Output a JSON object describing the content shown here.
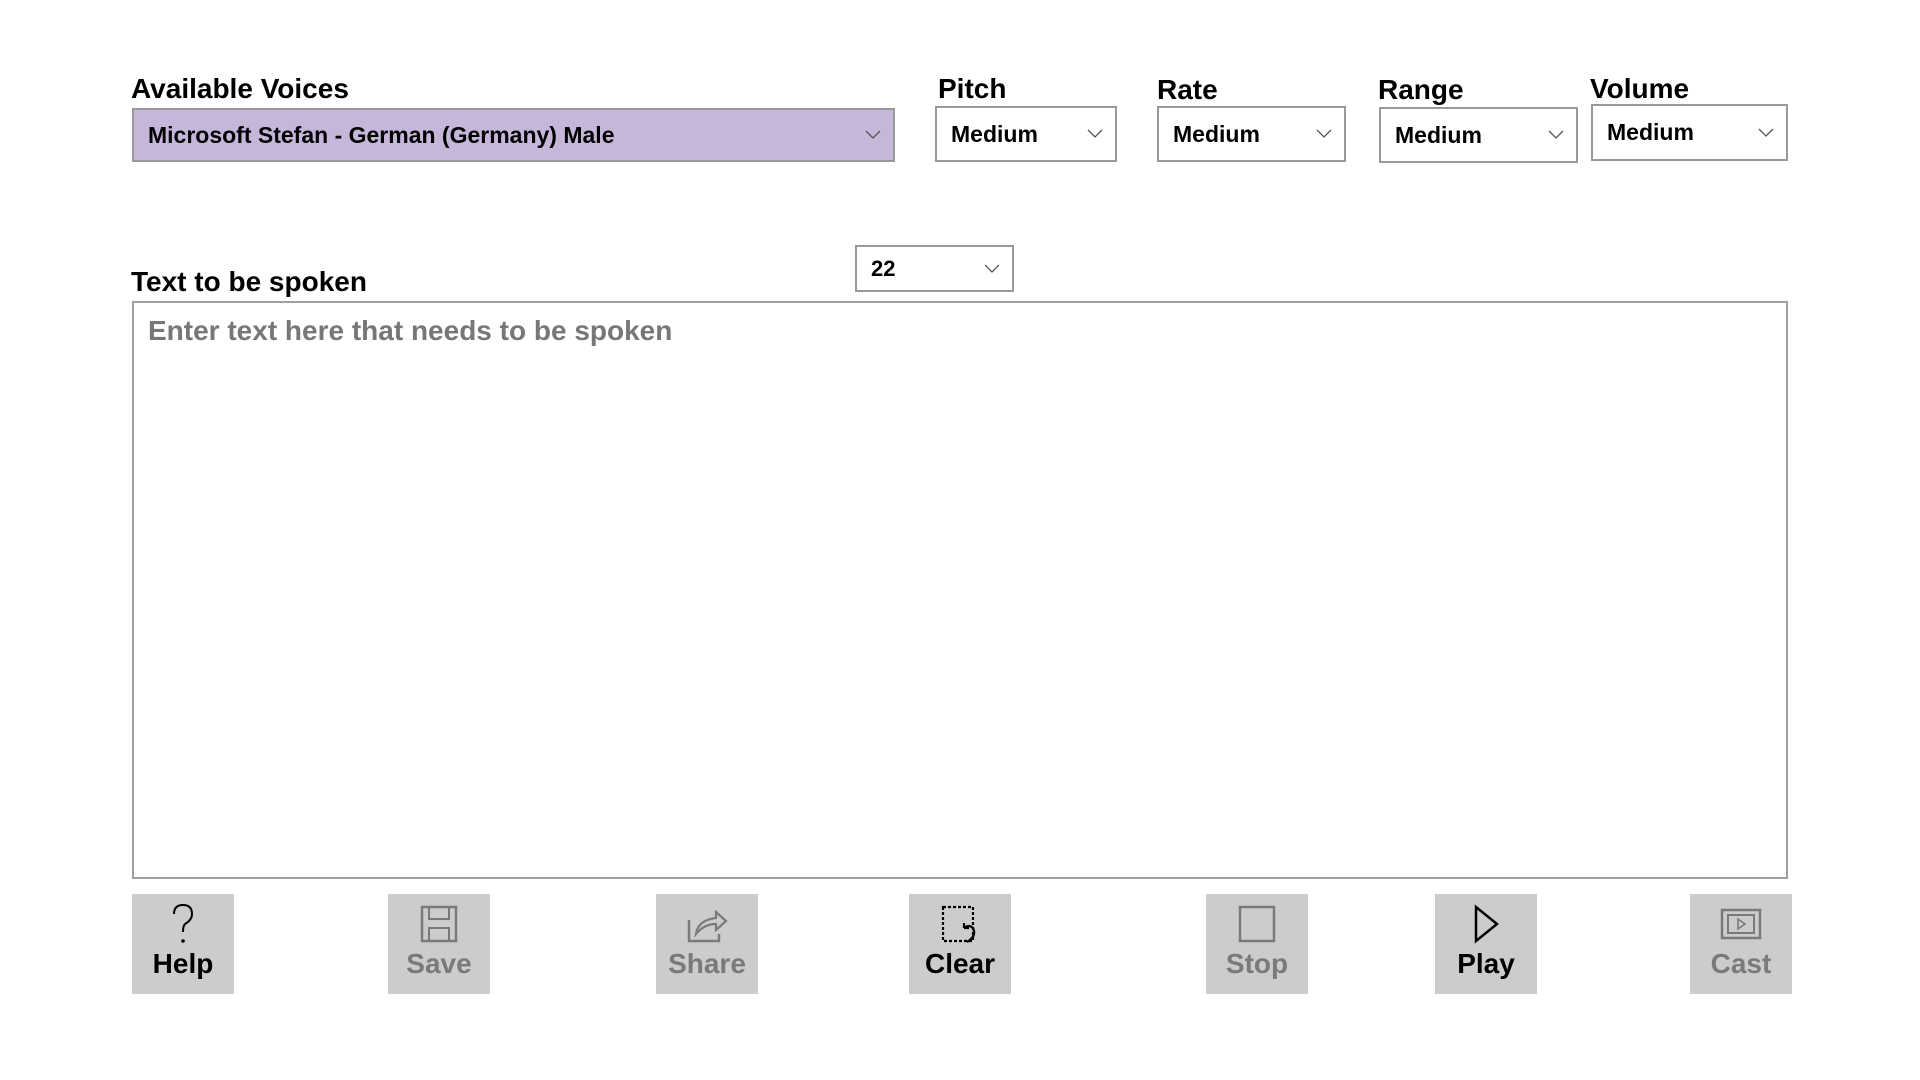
{
  "voices": {
    "label": "Available Voices",
    "selected": "Microsoft Stefan - German (Germany) Male"
  },
  "pitch": {
    "label": "Pitch",
    "selected": "Medium"
  },
  "rate": {
    "label": "Rate",
    "selected": "Medium"
  },
  "range": {
    "label": "Range",
    "selected": "Medium"
  },
  "volume": {
    "label": "Volume",
    "selected": "Medium"
  },
  "font_size": {
    "selected": "22"
  },
  "text": {
    "label": "Text to be spoken",
    "placeholder": "Enter text here that needs to be spoken",
    "value": ""
  },
  "buttons": [
    {
      "label": "Help",
      "icon": "question-icon",
      "enabled": true
    },
    {
      "label": "Save",
      "icon": "floppy-icon",
      "enabled": false
    },
    {
      "label": "Share",
      "icon": "share-icon",
      "enabled": false
    },
    {
      "label": "Clear",
      "icon": "clear-selection-icon",
      "enabled": true
    },
    {
      "label": "Stop",
      "icon": "stop-icon",
      "enabled": false
    },
    {
      "label": "Play",
      "icon": "play-icon",
      "enabled": true
    },
    {
      "label": "Cast",
      "icon": "cast-icon",
      "enabled": false
    }
  ],
  "colors": {
    "voice_bg": "#c6b6da",
    "button_bg": "#cccccc",
    "disabled_text": "#7a7a7a"
  }
}
